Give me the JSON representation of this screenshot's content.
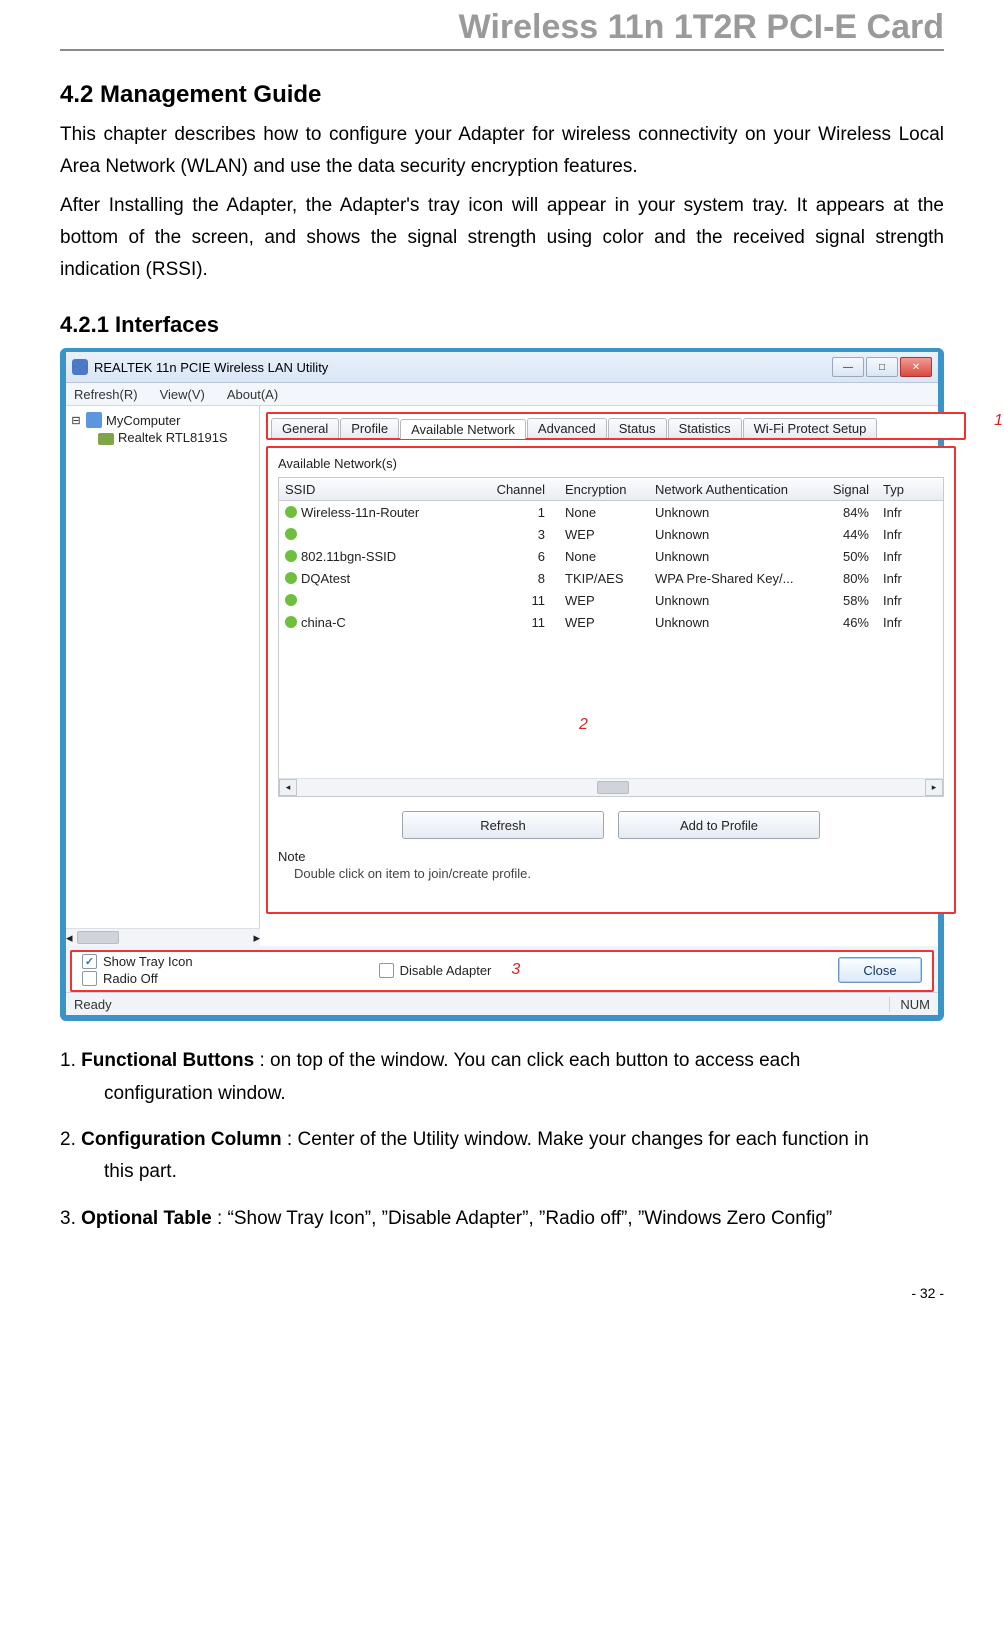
{
  "header_title": "Wireless 11n 1T2R PCI-E Card",
  "section_number_title": "4.2 Management Guide",
  "para1": "This chapter describes how to configure your Adapter for wireless connectivity on your Wireless Local Area Network (WLAN) and use the data security encryption features.",
  "para2": "After Installing the Adapter, the Adapter's tray icon will appear in your system tray. It appears at the bottom of the screen, and shows the signal strength using color and the received signal strength indication (RSSI).",
  "subsection_title": "4.2.1    Interfaces",
  "window": {
    "title": "REALTEK 11n PCIE Wireless LAN Utility",
    "menus": {
      "refresh": "Refresh(R)",
      "view": "View(V)",
      "about": "About(A)"
    },
    "tree": {
      "root": "MyComputer",
      "child": "Realtek RTL8191S"
    },
    "tabs": {
      "general": "General",
      "profile": "Profile",
      "available": "Available Network",
      "advanced": "Advanced",
      "status": "Status",
      "statistics": "Statistics",
      "wps": "Wi-Fi Protect Setup"
    },
    "callouts": {
      "c1": "1",
      "c2": "2",
      "c3": "3"
    },
    "group_label": "Available Network(s)",
    "columns": {
      "ssid": "SSID",
      "channel": "Channel",
      "encryption": "Encryption",
      "auth": "Network Authentication",
      "signal": "Signal",
      "type": "Typ"
    },
    "rows": [
      {
        "ssid": "Wireless-11n-Router",
        "ch": "1",
        "enc": "None",
        "auth": "Unknown",
        "sig": "84%",
        "typ": "Infr"
      },
      {
        "ssid": "",
        "ch": "3",
        "enc": "WEP",
        "auth": "Unknown",
        "sig": "44%",
        "typ": "Infr"
      },
      {
        "ssid": "802.11bgn-SSID",
        "ch": "6",
        "enc": "None",
        "auth": "Unknown",
        "sig": "50%",
        "typ": "Infr"
      },
      {
        "ssid": "DQAtest",
        "ch": "8",
        "enc": "TKIP/AES",
        "auth": "WPA Pre-Shared Key/...",
        "sig": "80%",
        "typ": "Infr"
      },
      {
        "ssid": "",
        "ch": "11",
        "enc": "WEP",
        "auth": "Unknown",
        "sig": "58%",
        "typ": "Infr"
      },
      {
        "ssid": "china-C",
        "ch": "11",
        "enc": "WEP",
        "auth": "Unknown",
        "sig": "46%",
        "typ": "Infr"
      }
    ],
    "buttons": {
      "refresh": "Refresh",
      "add": "Add to Profile",
      "close": "Close"
    },
    "note_label": "Note",
    "note_text": "Double click on item to join/create profile.",
    "options": {
      "show_tray": "Show Tray Icon",
      "disable": "Disable Adapter",
      "radio_off": "Radio Off"
    },
    "status": {
      "ready": "Ready",
      "num": "NUM"
    }
  },
  "list": {
    "i1_a": "1. ",
    "i1_b": "Functional Buttons",
    "i1_c": " : on top of the window. You can click each button to access each",
    "i1_d": "configuration window.",
    "i2_a": "2. ",
    "i2_b": "Configuration Column",
    "i2_c": " : Center of the Utility window. Make your changes for each function in",
    "i2_d": "this part.",
    "i3_a": "3. ",
    "i3_b": "Optional Table",
    "i3_c": " : “Show Tray Icon”, ”Disable Adapter”, ”Radio off”, ”Windows Zero Config”"
  },
  "page_number": "- 32 -"
}
